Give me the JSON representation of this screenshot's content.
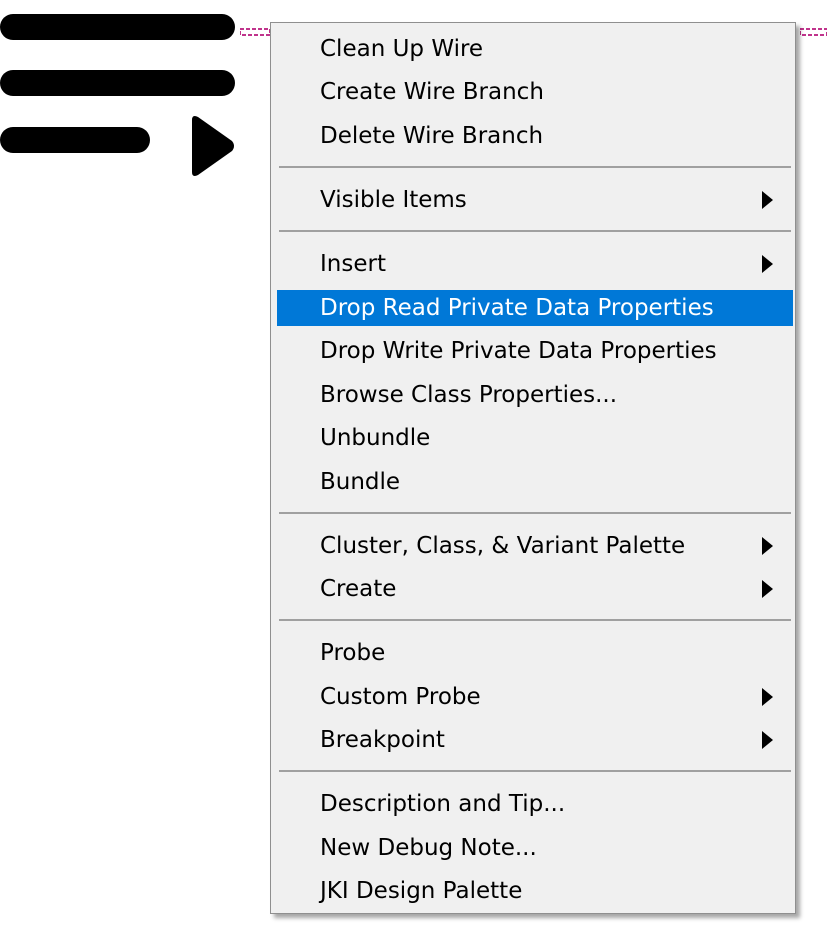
{
  "menu": {
    "items": [
      {
        "label": "Clean Up Wire"
      },
      {
        "label": "Create Wire Branch"
      },
      {
        "label": "Delete Wire Branch"
      },
      {
        "label": "Visible Items",
        "submenu": true
      },
      {
        "label": "Insert",
        "submenu": true
      },
      {
        "label": "Drop Read Private Data Properties",
        "highlighted": true
      },
      {
        "label": "Drop Write Private Data Properties"
      },
      {
        "label": "Browse Class Properties..."
      },
      {
        "label": "Unbundle"
      },
      {
        "label": "Bundle"
      },
      {
        "label": "Cluster, Class, & Variant Palette",
        "submenu": true
      },
      {
        "label": "Create",
        "submenu": true
      },
      {
        "label": "Probe"
      },
      {
        "label": "Custom Probe",
        "submenu": true
      },
      {
        "label": "Breakpoint",
        "submenu": true
      },
      {
        "label": "Description and Tip..."
      },
      {
        "label": "New Debug Note..."
      },
      {
        "label": "JKI Design Palette"
      }
    ]
  },
  "colors": {
    "highlight": "#0078d7",
    "menu_background": "#f0f0f0",
    "wire": "#c0348c"
  },
  "icons": {
    "quick_menu": "hamburger-run-icon",
    "submenu": "submenu-arrow-icon"
  }
}
